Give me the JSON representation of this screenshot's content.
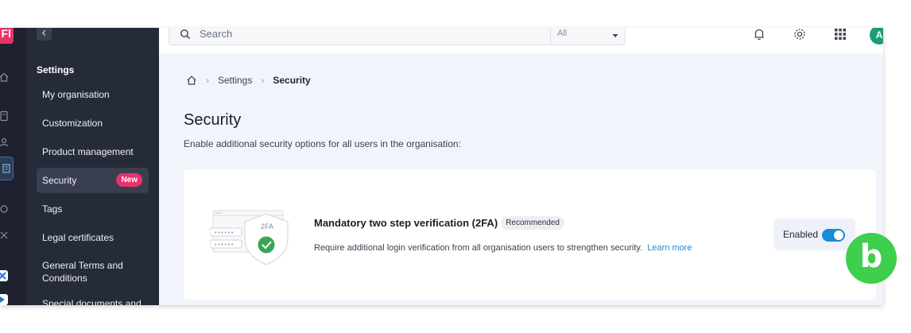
{
  "colors": {
    "sidebar_bg": "#262b39",
    "rail_bg": "#1e2230",
    "accent": "#1a8bd6",
    "badge_new": "#e8336a",
    "main_bg": "#f1f4fb",
    "brand_green": "#3ecf4c"
  },
  "rail": {
    "logo_text": "Fl",
    "icons": [
      "home-icon",
      "calculator-icon",
      "users-icon",
      "building-icon",
      "puzzle-icon",
      "cog-icon",
      "app-x-icon",
      "app-arrow-icon"
    ]
  },
  "sidebar": {
    "collapse_icon": "chevron-left-icon",
    "heading": "Settings",
    "items": [
      {
        "label": "My organisation"
      },
      {
        "label": "Customization"
      },
      {
        "label": "Product management"
      },
      {
        "label": "Security",
        "badge": "New",
        "active": true
      },
      {
        "label": "Tags"
      },
      {
        "label": "Legal certificates"
      },
      {
        "label": "General Terms and Conditions"
      },
      {
        "label": "Special documents and"
      }
    ]
  },
  "topbar": {
    "search": {
      "placeholder": "Search",
      "icon": "search-icon"
    },
    "scope": {
      "value": "All"
    },
    "icons": [
      "bell-icon",
      "gear-icon",
      "apps-grid-icon"
    ],
    "avatar_initial": "A"
  },
  "breadcrumb": {
    "home_icon": "home-icon",
    "items": [
      "Settings",
      "Security"
    ]
  },
  "page": {
    "title": "Security",
    "subtitle": "Enable additional security options for all users in the organisation:"
  },
  "card": {
    "illustration_label": "2FA",
    "title": "Mandatory two step verification (2FA)",
    "badge": "Recommended",
    "description": "Require additional login verification from all organisation users to strengthen security.",
    "link": "Learn more",
    "toggle_label": "Enabled",
    "toggle_on": true
  },
  "overlay": {
    "letter": "b"
  }
}
